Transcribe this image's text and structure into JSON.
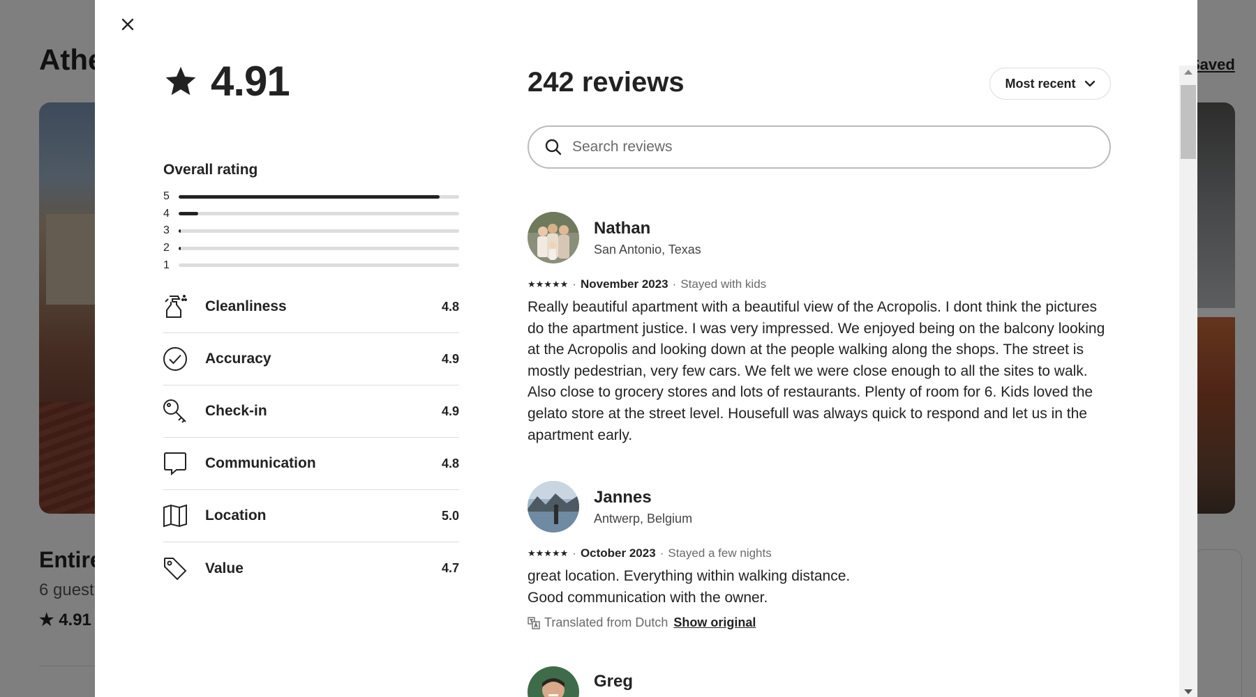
{
  "background": {
    "title": "Athe",
    "saved_label": "Saved",
    "listing_title": "Entire",
    "guests": "6 guest",
    "rating": "4.91"
  },
  "modal": {
    "close_icon": "close-icon",
    "overall": {
      "rating": "4.91",
      "rating_label": "Overall rating",
      "distribution": [
        {
          "stars": "5",
          "fraction": 0.93
        },
        {
          "stars": "4",
          "fraction": 0.07
        },
        {
          "stars": "3",
          "fraction": 0.008
        },
        {
          "stars": "2",
          "fraction": 0.008
        },
        {
          "stars": "1",
          "fraction": 0.0
        }
      ]
    },
    "categories": [
      {
        "name": "Cleanliness",
        "score": "4.8",
        "icon": "spray-bottle-icon"
      },
      {
        "name": "Accuracy",
        "score": "4.9",
        "icon": "check-circle-icon"
      },
      {
        "name": "Check-in",
        "score": "4.9",
        "icon": "key-icon"
      },
      {
        "name": "Communication",
        "score": "4.8",
        "icon": "chat-bubble-icon"
      },
      {
        "name": "Location",
        "score": "5.0",
        "icon": "map-icon"
      },
      {
        "name": "Value",
        "score": "4.7",
        "icon": "tag-icon"
      }
    ],
    "reviews_header": {
      "count": "242 reviews",
      "sort": "Most recent"
    },
    "search": {
      "placeholder": "Search reviews"
    },
    "reviews": [
      {
        "name": "Nathan",
        "location": "San Antonio, Texas",
        "stars": "★★★★★",
        "date": "November 2023",
        "stay": "Stayed with kids",
        "text": "Really beautiful apartment with a beautiful view of the Acropolis. I dont think the pictures do the apartment justice. I was very impressed. We enjoyed being on the balcony looking at the Acropolis and looking down at the people walking along the shops. The street is mostly pedestrian, very few cars. We felt we were close enough to all the sites to walk. Also close to grocery stores and lots of restaurants. Plenty of room for 6. Kids loved the gelato store at the street level. Housefull was always quick to respond and let us in the apartment early."
      },
      {
        "name": "Jannes",
        "location": "Antwerp, Belgium",
        "stars": "★★★★★",
        "date": "October 2023",
        "stay": "Stayed a few nights",
        "text_line1": "great location. Everything within walking distance.",
        "text_line2": "Good communication with the owner.",
        "translated": "Translated from Dutch",
        "show_original": "Show original"
      },
      {
        "name": "Greg"
      }
    ],
    "separator": "·"
  }
}
